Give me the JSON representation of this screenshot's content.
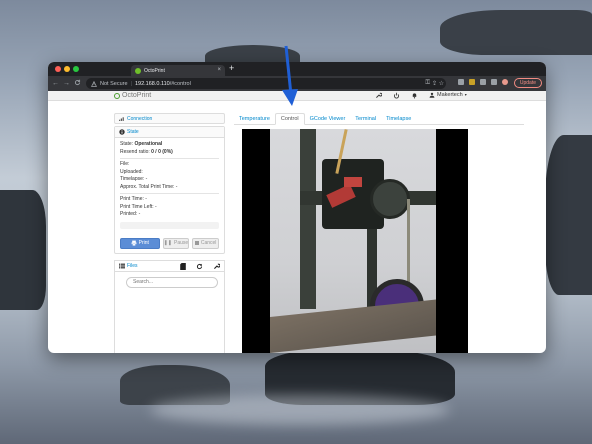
{
  "browser": {
    "tab_title": "OctoPrint",
    "tab_close": "×",
    "new_tab": "+",
    "security_label": "Not Secure",
    "url_host": "192.168.0.110",
    "url_path": "/#control",
    "update_label": "Update",
    "nav_back": "←",
    "nav_forward": "→",
    "nav_reload": "C",
    "nav_home": "⌂"
  },
  "navbar": {
    "brand": "OctoPrint",
    "user": "Makertech",
    "wrench": "🔧",
    "power": "⏻",
    "bell": "🔔"
  },
  "sidebar": {
    "connection_label": "Connection",
    "state_label": "State",
    "state_title": "State:",
    "state_value": "Operational",
    "resend_title": "Resend ratio:",
    "resend_value": "0 / 0 (0%)",
    "file": "File:",
    "uploaded": "Uploaded:",
    "timelapse": "Timelapse: -",
    "approx_time": "Approx. Total Print Time: -",
    "print_time": "Print Time: -",
    "time_left": "Print Time Left: -",
    "printed": "Printed: -",
    "print_btn": "Print",
    "pause_btn": "Pause",
    "cancel_btn": "Cancel",
    "files_label": "Files",
    "search_placeholder": "Search..."
  },
  "tabs": [
    "Temperature",
    "Control",
    "GCode Viewer",
    "Terminal",
    "Timelapse"
  ],
  "active_tab": "Control",
  "colors": {
    "link": "#0088cc",
    "primary_button": "#5b8dd6",
    "annotation_arrow": "#1f5fd6",
    "update_button": "#f28b82"
  },
  "icons": [
    "shield-warning-icon",
    "key-icon",
    "share-icon",
    "star-icon",
    "extension-icon",
    "sidebar-icon",
    "signal-icon",
    "info-icon",
    "list-icon",
    "sd-card-icon",
    "refresh-icon",
    "wrench-icon",
    "power-icon",
    "bell-icon",
    "user-icon"
  ]
}
